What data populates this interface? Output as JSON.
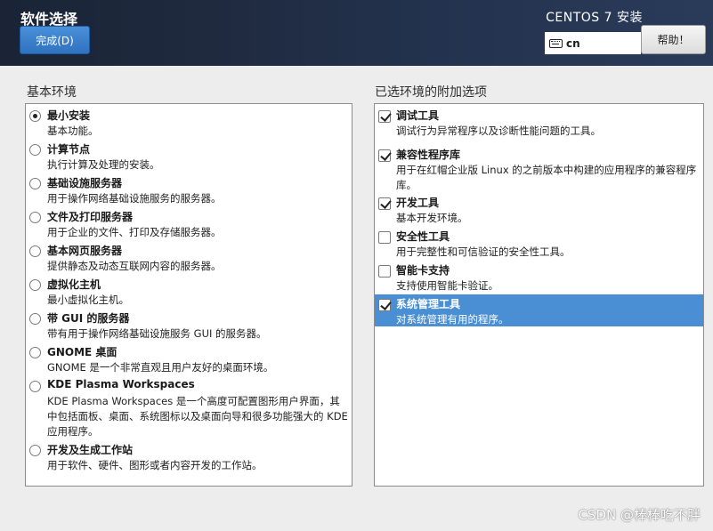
{
  "header": {
    "title": "软件选择",
    "done_label": "完成(D)",
    "product": "CENTOS 7 安装",
    "keyboard_layout": "cn",
    "help_label": "帮助！"
  },
  "base_environment": {
    "heading": "基本环境",
    "items": [
      {
        "title": "最小安装",
        "desc": "基本功能。",
        "selected": true
      },
      {
        "title": "计算节点",
        "desc": "执行计算及处理的安装。",
        "selected": false
      },
      {
        "title": "基础设施服务器",
        "desc": "用于操作网络基础设施服务的服务器。",
        "selected": false
      },
      {
        "title": "文件及打印服务器",
        "desc": "用于企业的文件、打印及存储服务器。",
        "selected": false
      },
      {
        "title": "基本网页服务器",
        "desc": "提供静态及动态互联网内容的服务器。",
        "selected": false
      },
      {
        "title": "虚拟化主机",
        "desc": "最小虚拟化主机。",
        "selected": false
      },
      {
        "title": "带 GUI 的服务器",
        "desc": "带有用于操作网络基础设施服务 GUI 的服务器。",
        "selected": false
      },
      {
        "title": "GNOME 桌面",
        "desc": "GNOME 是一个非常直观且用户友好的桌面环境。",
        "selected": false
      },
      {
        "title": "KDE Plasma Workspaces",
        "desc": "KDE Plasma Workspaces 是一个高度可配置图形用户界面，其中包括面板、桌面、系统图标以及桌面向导和很多功能强大的 KDE 应用程序。",
        "selected": false
      },
      {
        "title": "开发及生成工作站",
        "desc": "用于软件、硬件、图形或者内容开发的工作站。",
        "selected": false
      }
    ]
  },
  "addons": {
    "heading": "已选环境的附加选项",
    "items": [
      {
        "title": "调试工具",
        "desc": "调试行为异常程序以及诊断性能问题的工具。",
        "checked": true
      },
      {
        "title": "兼容性程序库",
        "desc": "用于在红帽企业版 Linux 的之前版本中构建的应用程序的兼容程序库。",
        "checked": true
      },
      {
        "title": "开发工具",
        "desc": "基本开发环境。",
        "checked": true
      },
      {
        "title": "安全性工具",
        "desc": "用于完整性和可信验证的安全性工具。",
        "checked": false
      },
      {
        "title": "智能卡支持",
        "desc": "支持使用智能卡验证。",
        "checked": false
      },
      {
        "title": "系统管理工具",
        "desc": "对系统管理有用的程序。",
        "checked": true,
        "highlighted": true
      }
    ]
  },
  "watermark": "CSDN @棒棒吃不胖",
  "colors": {
    "header_bg": "#1f2a3f",
    "accent": "#4a8fd4",
    "done_button": "#3a80cc"
  }
}
